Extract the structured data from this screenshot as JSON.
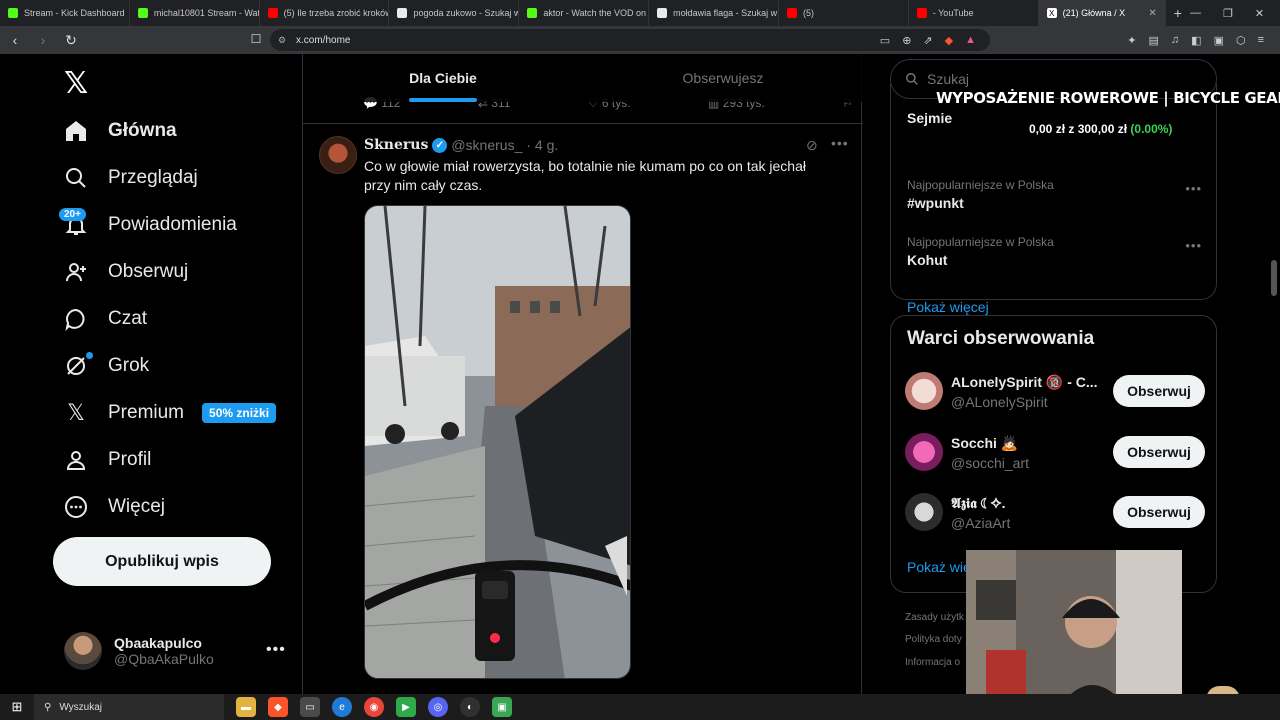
{
  "browser": {
    "tabs": [
      {
        "title": "Stream - Kick Dashboard",
        "color": "#53fc18"
      },
      {
        "title": "michal10801 Stream - Watch L",
        "color": "#53fc18"
      },
      {
        "title": "(5) Ile trzeba zrobić kroków, że",
        "color": "#ff0000"
      },
      {
        "title": "pogoda zukowo - Szukaj w Go",
        "color": "#e8eaed"
      },
      {
        "title": "aktor - Watch the VOD on Kick",
        "color": "#53fc18"
      },
      {
        "title": "mołdawia flaga - Szukaj w Goo",
        "color": "#e8eaed"
      },
      {
        "title": "(5)",
        "color": "#ff0000"
      },
      {
        "title": "- YouTube",
        "color": "#ff0000"
      }
    ],
    "active_tab": "(21) Główna / X",
    "url": "x.com/home"
  },
  "nav": {
    "items": [
      {
        "label": "Główna",
        "icon": "home-icon"
      },
      {
        "label": "Przeglądaj",
        "icon": "search-icon"
      },
      {
        "label": "Powiadomienia",
        "icon": "bell-icon"
      },
      {
        "label": "Obserwuj",
        "icon": "add-user-icon"
      },
      {
        "label": "Czat",
        "icon": "chat-icon"
      },
      {
        "label": "Grok",
        "icon": "grok-icon"
      },
      {
        "label": "Premium",
        "icon": "x-icon"
      },
      {
        "label": "Profil",
        "icon": "profile-icon"
      },
      {
        "label": "Więcej",
        "icon": "more-icon"
      }
    ],
    "notif_badge": "20+",
    "premium_badge": "50% zniżki",
    "publish_label": "Opublikuj wpis",
    "profile": {
      "name": "Qbaakapulco",
      "handle": "@QbaAkaPulko"
    }
  },
  "feed": {
    "tabs": [
      "Dla Ciebie",
      "Obserwujesz"
    ],
    "prev_actions": [
      "112",
      "311",
      "6 tys.",
      "293 tys."
    ],
    "tweet": {
      "name": "Sknerus",
      "handle": "@sknerus_",
      "time": "· 4 g.",
      "text": "Co w głowie miał rowerzysta, bo totalnie nie kumam po co on tak jechał przy nim cały czas."
    }
  },
  "sidebar": {
    "search_placeholder": "Szukaj",
    "trends": [
      {
        "context": "",
        "title": "Sejmie"
      },
      {
        "context": "Najpopularniejsze w Polska",
        "title": "#wpunkt"
      },
      {
        "context": "Najpopularniejsze w Polska",
        "title": "Kohut"
      }
    ],
    "show_more": "Pokaż więcej",
    "wtf_title": "Warci obserwowania",
    "wtf": [
      {
        "name": "ALonelySpirit 🔞 - C...",
        "handle": "@ALonelySpirit",
        "color": "#e9c9c0"
      },
      {
        "name": "Socchi 🙇🏻",
        "handle": "@socchi_art",
        "color": "#c03a8a"
      },
      {
        "name": "𝕬𝖟𝖎𝖆 ☾✧.",
        "handle": "@AziaArt",
        "color": "#6d6d6d"
      }
    ],
    "follow_label": "Obserwuj",
    "show_more_2": "Pokaż wię",
    "footer": [
      "Zasady użytk",
      "Polityka doty",
      "Informacja o"
    ]
  },
  "overlay": {
    "title": "WYPOSAŻENIE ROWEROWE | BICYCLE GEAR",
    "amount_text": "0,00 zł z 300,00 zł",
    "percent": "(0.00%)",
    "progress_fraction": 0.0
  },
  "taskbar": {
    "search_label": "Wyszukaj"
  }
}
